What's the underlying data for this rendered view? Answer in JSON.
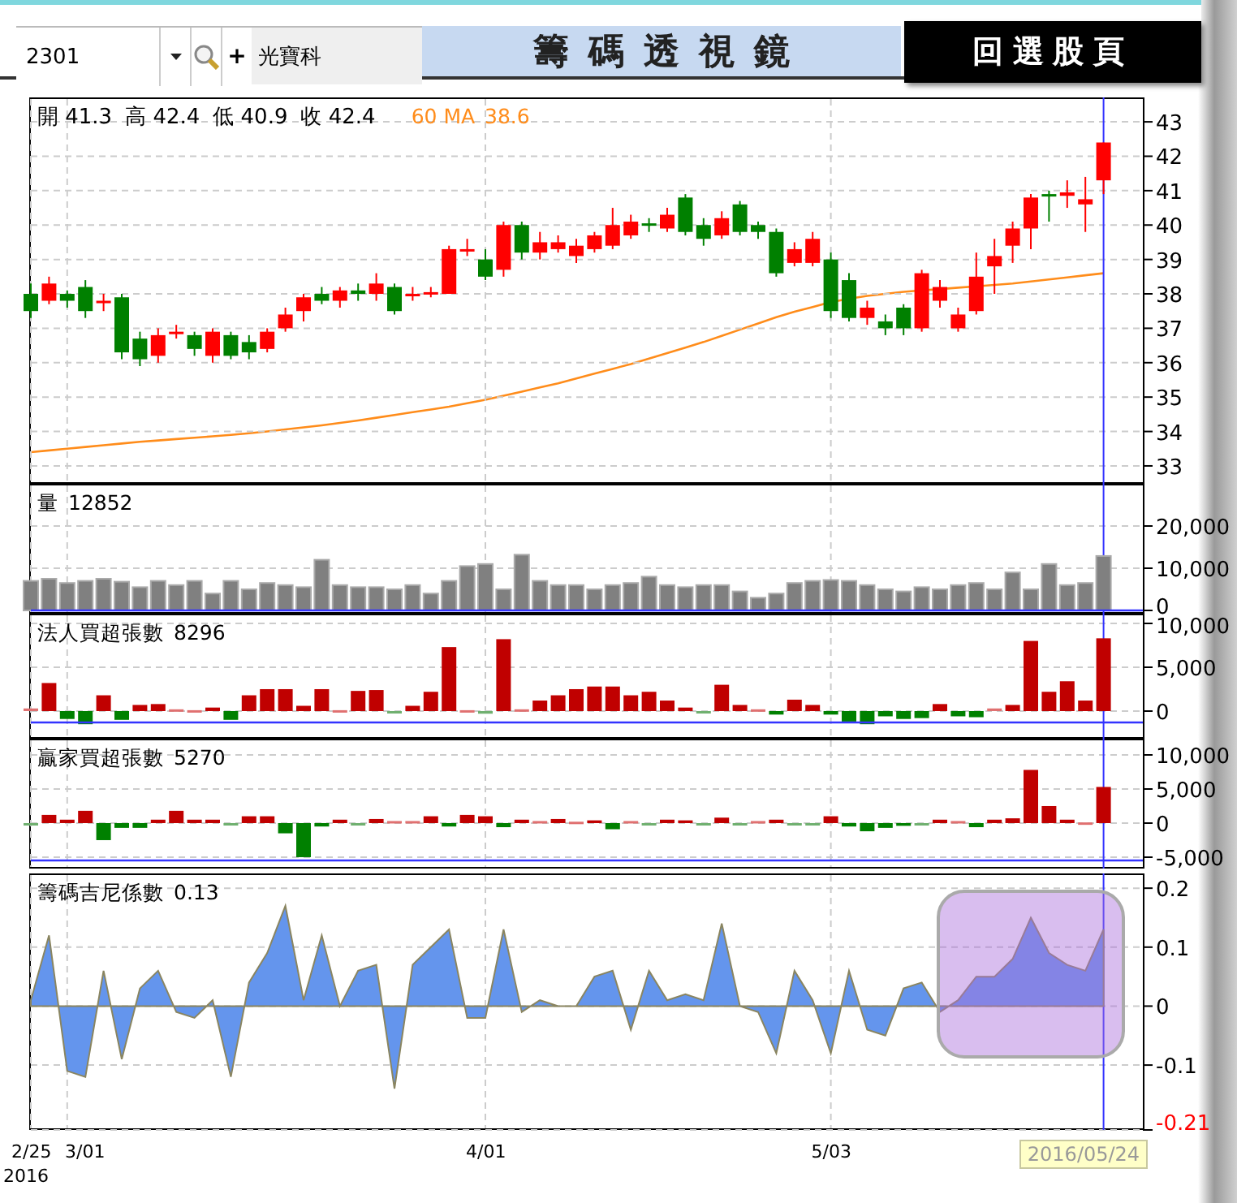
{
  "toolbar": {
    "stock_code": "2301",
    "add_button": "+",
    "stock_name": "光寶科",
    "title": "籌碼透視鏡",
    "back_button": "回選股頁"
  },
  "price_panel": {
    "legend": [
      "開 41.3",
      "高 42.4",
      "低 40.9",
      "收 42.4"
    ],
    "ma_label": "60 MA",
    "ma_value": "38.6",
    "chart_data": {
      "type": "candlestick",
      "grid": true,
      "ylim": [
        32.48,
        43.71
      ],
      "yticks": [
        33,
        34,
        35,
        36,
        37,
        38,
        39,
        40,
        41,
        42,
        43
      ],
      "ohlc": [
        [
          38.0,
          38.3,
          37.3,
          37.5
        ],
        [
          37.8,
          38.5,
          37.7,
          38.3
        ],
        [
          38.0,
          38.1,
          37.6,
          37.8
        ],
        [
          38.2,
          38.4,
          37.3,
          37.5
        ],
        [
          37.75,
          38.0,
          37.5,
          37.8
        ],
        [
          37.9,
          38.0,
          36.1,
          36.3
        ],
        [
          36.7,
          36.9,
          35.9,
          36.1
        ],
        [
          36.2,
          37.0,
          36.0,
          36.8
        ],
        [
          36.85,
          37.1,
          36.7,
          36.9
        ],
        [
          36.8,
          36.9,
          36.2,
          36.4
        ],
        [
          36.2,
          37.0,
          36.0,
          36.9
        ],
        [
          36.8,
          36.9,
          36.1,
          36.2
        ],
        [
          36.6,
          36.8,
          36.1,
          36.3
        ],
        [
          36.4,
          37.0,
          36.3,
          36.9
        ],
        [
          37.0,
          37.6,
          36.9,
          37.4
        ],
        [
          37.5,
          38.0,
          37.2,
          37.9
        ],
        [
          38.0,
          38.2,
          37.7,
          37.8
        ],
        [
          37.8,
          38.2,
          37.6,
          38.1
        ],
        [
          38.1,
          38.3,
          37.8,
          38.0
        ],
        [
          38.0,
          38.6,
          37.8,
          38.3
        ],
        [
          38.2,
          38.3,
          37.4,
          37.5
        ],
        [
          37.95,
          38.2,
          37.8,
          38.0
        ],
        [
          38.0,
          38.2,
          37.9,
          38.05
        ],
        [
          38.0,
          39.4,
          38.0,
          39.3
        ],
        [
          39.25,
          39.6,
          39.1,
          39.3
        ],
        [
          39.0,
          39.3,
          38.4,
          38.5
        ],
        [
          38.7,
          40.1,
          38.5,
          40.0
        ],
        [
          40.0,
          40.1,
          39.0,
          39.2
        ],
        [
          39.2,
          39.8,
          39.0,
          39.5
        ],
        [
          39.3,
          39.7,
          39.2,
          39.5
        ],
        [
          39.1,
          39.6,
          38.9,
          39.4
        ],
        [
          39.3,
          39.8,
          39.2,
          39.7
        ],
        [
          39.4,
          40.5,
          39.3,
          40.0
        ],
        [
          39.7,
          40.3,
          39.6,
          40.1
        ],
        [
          40.05,
          40.2,
          39.8,
          40.0
        ],
        [
          39.9,
          40.5,
          39.8,
          40.3
        ],
        [
          40.8,
          40.9,
          39.7,
          39.8
        ],
        [
          40.0,
          40.2,
          39.4,
          39.6
        ],
        [
          39.7,
          40.4,
          39.6,
          40.2
        ],
        [
          40.6,
          40.7,
          39.7,
          39.8
        ],
        [
          40.0,
          40.1,
          39.6,
          39.8
        ],
        [
          39.8,
          39.9,
          38.5,
          38.6
        ],
        [
          38.9,
          39.5,
          38.8,
          39.3
        ],
        [
          38.9,
          39.8,
          38.8,
          39.6
        ],
        [
          39.0,
          39.2,
          37.3,
          37.5
        ],
        [
          38.4,
          38.6,
          37.2,
          37.3
        ],
        [
          37.3,
          37.8,
          37.1,
          37.6
        ],
        [
          37.2,
          37.4,
          36.8,
          37.0
        ],
        [
          37.6,
          37.7,
          36.8,
          37.0
        ],
        [
          37.0,
          38.7,
          36.9,
          38.6
        ],
        [
          37.8,
          38.4,
          37.6,
          38.2
        ],
        [
          37.0,
          37.6,
          36.9,
          37.4
        ],
        [
          37.5,
          39.2,
          37.4,
          38.5
        ],
        [
          38.8,
          39.6,
          38.0,
          39.1
        ],
        [
          39.4,
          40.1,
          38.9,
          39.9
        ],
        [
          39.9,
          40.9,
          39.3,
          40.8
        ],
        [
          40.9,
          41.0,
          40.1,
          40.85
        ],
        [
          40.85,
          41.3,
          40.5,
          40.95
        ],
        [
          40.6,
          41.4,
          39.8,
          40.75
        ],
        [
          41.3,
          42.4,
          40.9,
          42.4
        ]
      ]
    }
  },
  "volume_panel": {
    "value": "12852",
    "chart_data": {
      "type": "bar",
      "grid": true,
      "ylim": [
        -770,
        30000
      ],
      "yticks": [
        {
          "value": 0,
          "label": "0"
        },
        {
          "value": 10000,
          "label": "10,000"
        },
        {
          "value": 20000,
          "label": "20,000"
        }
      ],
      "series": [
        {
          "name": "量",
          "color": "#808080",
          "values": [
            7000,
            7500,
            6500,
            7000,
            7500,
            6800,
            5500,
            7000,
            6000,
            7000,
            4000,
            7000,
            5000,
            6500,
            6000,
            5500,
            12000,
            6000,
            5500,
            5500,
            5000,
            6000,
            4000,
            7000,
            10500,
            11000,
            5000,
            13200,
            7000,
            6000,
            6000,
            5000,
            6000,
            6500,
            8000,
            6000,
            5500,
            6000,
            6000,
            4500,
            3000,
            4000,
            6500,
            7000,
            7200,
            7000,
            6000,
            5000,
            4500,
            5500,
            5000,
            6000,
            6500,
            5000,
            9000,
            5000,
            11000,
            6000,
            6500,
            12900
          ]
        }
      ]
    }
  },
  "institutional_panel": {
    "value": "8296",
    "chart_data": {
      "type": "bar",
      "grid": true,
      "ylim": [
        -3150,
        11110
      ],
      "yticks": [
        {
          "value": 0,
          "label": "0"
        },
        {
          "value": 5000,
          "label": "5,000"
        },
        {
          "value": 10000,
          "label": "10,000"
        }
      ],
      "series": [
        {
          "name": "法人買超張數",
          "values": [
            300,
            3200,
            -900,
            -1500,
            1800,
            -1000,
            700,
            800,
            200,
            100,
            400,
            -1000,
            1800,
            2500,
            2500,
            600,
            2500,
            100,
            2300,
            2400,
            -200,
            600,
            2200,
            7300,
            100,
            -300,
            8200,
            200,
            1200,
            1800,
            2500,
            2800,
            2800,
            1800,
            2200,
            1200,
            400,
            -200,
            3000,
            700,
            200,
            -400,
            1300,
            700,
            -400,
            -1200,
            -1500,
            -600,
            -900,
            -800,
            800,
            -600,
            -700,
            300,
            700,
            8000,
            2200,
            3400,
            1200,
            8300
          ]
        }
      ]
    }
  },
  "winner_panel": {
    "value": "5270",
    "chart_data": {
      "type": "bar",
      "grid": true,
      "ylim": [
        -6670,
        12380
      ],
      "yticks": [
        {
          "value": -5000,
          "label": "-5,000"
        },
        {
          "value": 0,
          "label": "0"
        },
        {
          "value": 5000,
          "label": "5,000"
        },
        {
          "value": 10000,
          "label": "10,000"
        }
      ],
      "series": [
        {
          "name": "贏家買超張數",
          "values": [
            -300,
            1200,
            500,
            1800,
            -2500,
            -700,
            -700,
            500,
            1800,
            500,
            500,
            -300,
            1000,
            1000,
            -1500,
            -5000,
            -500,
            500,
            -200,
            600,
            300,
            300,
            1000,
            -500,
            1200,
            1000,
            -600,
            500,
            300,
            600,
            200,
            400,
            -900,
            300,
            -300,
            500,
            400,
            -200,
            800,
            -200,
            300,
            500,
            -300,
            -200,
            1000,
            -500,
            -1200,
            -700,
            -400,
            -300,
            500,
            300,
            -600,
            500,
            700,
            7800,
            2500,
            500,
            100,
            5300
          ]
        }
      ]
    }
  },
  "gini_panel": {
    "value": "0.13",
    "chart_data": {
      "type": "area",
      "grid": true,
      "ylim": [
        -0.21,
        0.225
      ],
      "yticks": [
        {
          "value": -0.21,
          "label": "-0.21"
        },
        {
          "value": -0.1,
          "label": "-0.1"
        },
        {
          "value": 0,
          "label": "0"
        },
        {
          "value": 0.1,
          "label": "0.1"
        },
        {
          "value": 0.2,
          "label": "0.2"
        }
      ],
      "series": [
        {
          "name": "籌碼吉尼係數",
          "color": "#6495ed",
          "values": [
            0.01,
            0.12,
            -0.11,
            -0.12,
            0.06,
            -0.09,
            0.03,
            0.06,
            -0.01,
            -0.02,
            0.01,
            -0.12,
            0.04,
            0.09,
            0.17,
            0.01,
            0.12,
            0.0,
            0.06,
            0.07,
            -0.14,
            0.07,
            0.1,
            0.13,
            -0.02,
            -0.02,
            0.13,
            -0.01,
            0.01,
            0.0,
            0.0,
            0.05,
            0.06,
            -0.04,
            0.06,
            0.01,
            0.02,
            0.01,
            0.14,
            0.0,
            -0.01,
            -0.08,
            0.06,
            0.01,
            -0.08,
            0.06,
            -0.04,
            -0.05,
            0.03,
            0.04,
            -0.01,
            0.01,
            0.05,
            0.05,
            0.08,
            0.15,
            0.09,
            0.07,
            0.06,
            0.13
          ]
        }
      ]
    }
  },
  "x_axis": {
    "xticks": [
      "2/25",
      "3/01",
      "4/01",
      "5/03"
    ],
    "year": "2016",
    "cursor_label": "2016/05/24"
  }
}
